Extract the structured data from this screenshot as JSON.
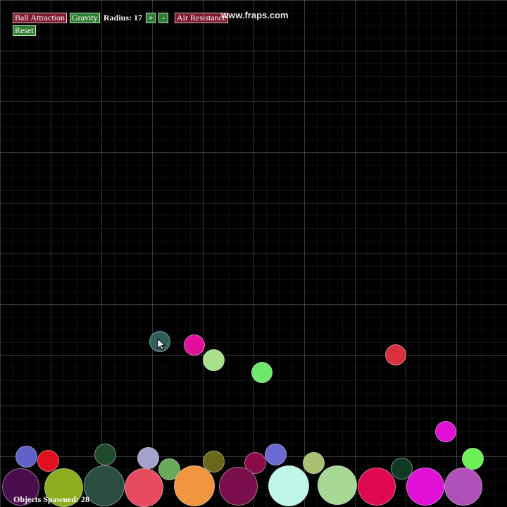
{
  "toolbar": {
    "ball_attraction_label": "Ball Attraction",
    "gravity_label": "Gravity",
    "radius_label": "Radius: 17",
    "increase_label": "+",
    "decrease_label": "-",
    "air_resistance_label": "Air Resistance",
    "reset_label": "Reset"
  },
  "watermark": "www.fraps.com",
  "status": {
    "objects_spawned": "Objects Spawned: 28"
  },
  "colors": {
    "toggle_off": "#7b1a2a",
    "toggle_on": "#2f7d32",
    "background": "#000000",
    "grid": "#333333"
  },
  "balls": [
    {
      "color": "#2f5f5c"
    },
    {
      "color": "#e0109a"
    },
    {
      "color": "#a8e08c"
    },
    {
      "color": "#6de86b"
    },
    {
      "color": "#d8303e"
    },
    {
      "color": "#e010d6"
    },
    {
      "color": "#6cf054"
    },
    {
      "color": "#6060c8"
    },
    {
      "color": "#e01020"
    },
    {
      "color": "#1f4a2c"
    },
    {
      "color": "#a2a2cc"
    },
    {
      "color": "#6aa85a"
    },
    {
      "color": "#6a6818"
    },
    {
      "color": "#8a0a4a"
    },
    {
      "color": "#6a6ad0"
    },
    {
      "color": "#a8c070"
    },
    {
      "color": "#0e3a24"
    },
    {
      "color": "#4a0e4e"
    },
    {
      "color": "#8aae20"
    },
    {
      "color": "#2a4e40"
    },
    {
      "color": "#e84a60"
    },
    {
      "color": "#f09640"
    },
    {
      "color": "#7a0e4a"
    },
    {
      "color": "#c0f6ea"
    },
    {
      "color": "#a8d896"
    },
    {
      "color": "#e00850"
    },
    {
      "color": "#e010d6"
    },
    {
      "color": "#b050b8"
    }
  ]
}
